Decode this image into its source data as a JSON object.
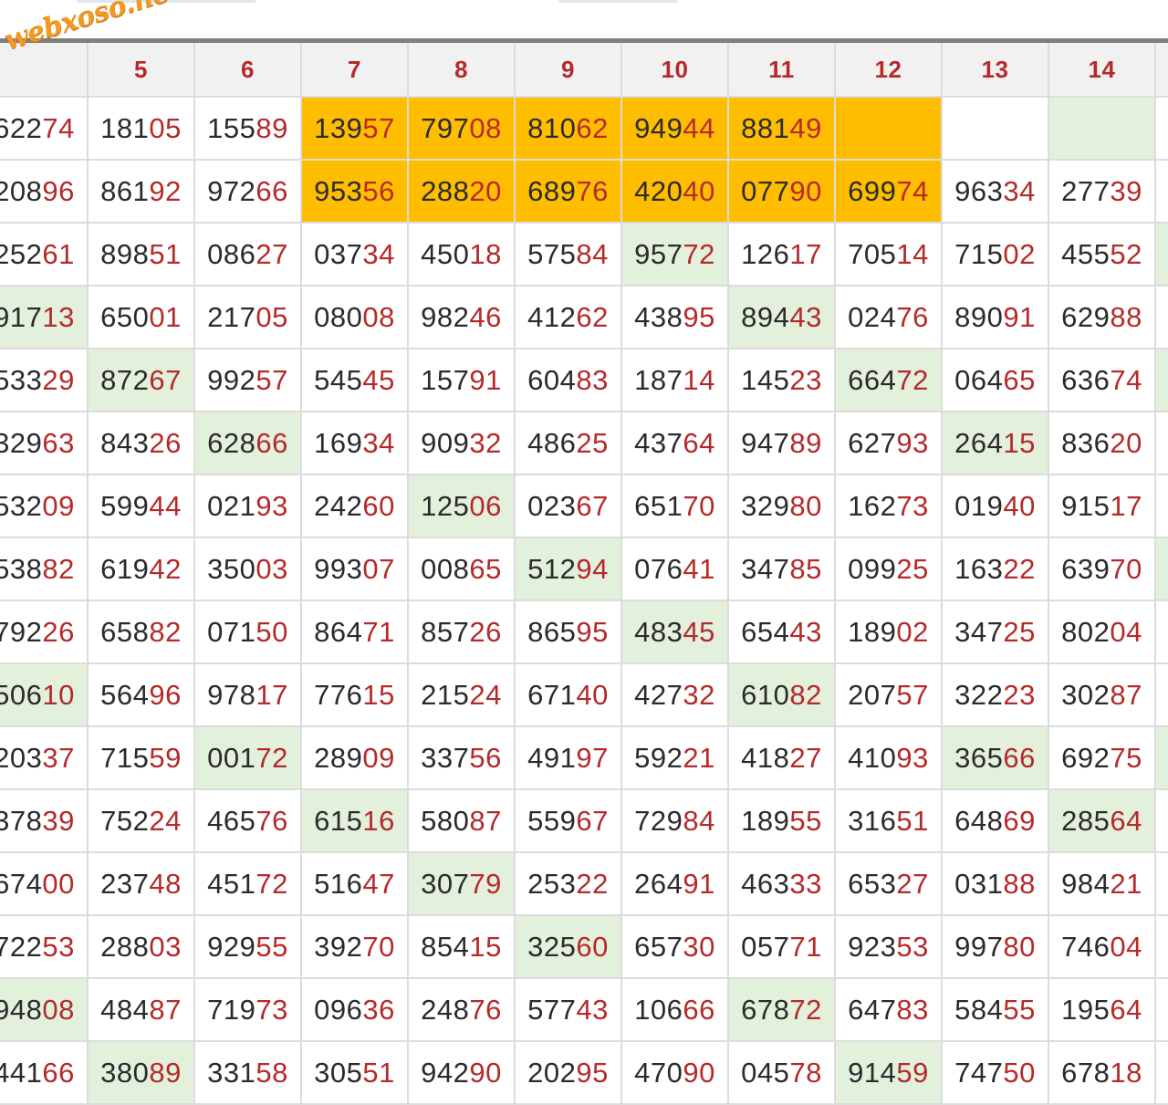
{
  "logo": {
    "text": "webxoso.net",
    "color": "#f29a22"
  },
  "colors": {
    "highlight": "#ffbd00",
    "green": "#e3f0dc",
    "header_text": "#b52a2a",
    "tail_digits": "#b52a2a"
  },
  "headers": [
    "",
    "5",
    "6",
    "7",
    "8",
    "9",
    "10",
    "11",
    "12",
    "13",
    "14"
  ],
  "rows": [
    [
      {
        "v": "62274"
      },
      {
        "v": "18105"
      },
      {
        "v": "15589"
      },
      {
        "v": "13957",
        "h": "y"
      },
      {
        "v": "79708",
        "h": "y"
      },
      {
        "v": "81062",
        "h": "y"
      },
      {
        "v": "94944",
        "h": "y"
      },
      {
        "v": "88149",
        "h": "y"
      },
      {
        "v": "",
        "h": "y"
      },
      {
        "v": ""
      },
      {
        "v": "",
        "h": "g"
      }
    ],
    [
      {
        "v": "20896"
      },
      {
        "v": "86192"
      },
      {
        "v": "97266"
      },
      {
        "v": "95356",
        "h": "y"
      },
      {
        "v": "28820",
        "h": "y"
      },
      {
        "v": "68976",
        "h": "y"
      },
      {
        "v": "42040",
        "h": "y"
      },
      {
        "v": "07790",
        "h": "y"
      },
      {
        "v": "69974",
        "h": "y"
      },
      {
        "v": "96334"
      },
      {
        "v": "27739"
      }
    ],
    [
      {
        "v": "25261"
      },
      {
        "v": "89851"
      },
      {
        "v": "08627"
      },
      {
        "v": "03734"
      },
      {
        "v": "45018"
      },
      {
        "v": "57584"
      },
      {
        "v": "95772",
        "h": "g"
      },
      {
        "v": "12617"
      },
      {
        "v": "70514"
      },
      {
        "v": "71502"
      },
      {
        "v": "45552"
      }
    ],
    [
      {
        "v": "91713",
        "h": "g"
      },
      {
        "v": "65001"
      },
      {
        "v": "21705"
      },
      {
        "v": "08008"
      },
      {
        "v": "98246"
      },
      {
        "v": "41262"
      },
      {
        "v": "43895"
      },
      {
        "v": "89443",
        "h": "g"
      },
      {
        "v": "02476"
      },
      {
        "v": "89091"
      },
      {
        "v": "62988"
      }
    ],
    [
      {
        "v": "53329"
      },
      {
        "v": "87267",
        "h": "g"
      },
      {
        "v": "99257"
      },
      {
        "v": "54545"
      },
      {
        "v": "15791"
      },
      {
        "v": "60483"
      },
      {
        "v": "18714"
      },
      {
        "v": "14523"
      },
      {
        "v": "66472",
        "h": "g"
      },
      {
        "v": "06465"
      },
      {
        "v": "63674"
      }
    ],
    [
      {
        "v": "32963"
      },
      {
        "v": "84326"
      },
      {
        "v": "62866",
        "h": "g"
      },
      {
        "v": "16934"
      },
      {
        "v": "90932"
      },
      {
        "v": "48625"
      },
      {
        "v": "43764"
      },
      {
        "v": "94789"
      },
      {
        "v": "62793"
      },
      {
        "v": "26415",
        "h": "g"
      },
      {
        "v": "83620"
      }
    ],
    [
      {
        "v": "53209"
      },
      {
        "v": "59944"
      },
      {
        "v": "02193"
      },
      {
        "v": "24260"
      },
      {
        "v": "12506",
        "h": "g"
      },
      {
        "v": "02367"
      },
      {
        "v": "65170"
      },
      {
        "v": "32980"
      },
      {
        "v": "16273"
      },
      {
        "v": "01940"
      },
      {
        "v": "91517"
      }
    ],
    [
      {
        "v": "53882"
      },
      {
        "v": "61942"
      },
      {
        "v": "35003"
      },
      {
        "v": "99307"
      },
      {
        "v": "00865"
      },
      {
        "v": "51294",
        "h": "g"
      },
      {
        "v": "07641"
      },
      {
        "v": "34785"
      },
      {
        "v": "09925"
      },
      {
        "v": "16322"
      },
      {
        "v": "63970"
      }
    ],
    [
      {
        "v": "79226"
      },
      {
        "v": "65882"
      },
      {
        "v": "07150"
      },
      {
        "v": "86471"
      },
      {
        "v": "85726"
      },
      {
        "v": "86595"
      },
      {
        "v": "48345",
        "h": "g"
      },
      {
        "v": "65443"
      },
      {
        "v": "18902"
      },
      {
        "v": "34725"
      },
      {
        "v": "80204"
      }
    ],
    [
      {
        "v": "50610",
        "h": "g"
      },
      {
        "v": "56496"
      },
      {
        "v": "97817"
      },
      {
        "v": "77615"
      },
      {
        "v": "21524"
      },
      {
        "v": "67140"
      },
      {
        "v": "42732"
      },
      {
        "v": "61082",
        "h": "g"
      },
      {
        "v": "20757"
      },
      {
        "v": "32223"
      },
      {
        "v": "30287"
      }
    ],
    [
      {
        "v": "20337"
      },
      {
        "v": "71559"
      },
      {
        "v": "00172",
        "h": "g"
      },
      {
        "v": "28909"
      },
      {
        "v": "33756"
      },
      {
        "v": "49197"
      },
      {
        "v": "59221"
      },
      {
        "v": "41827"
      },
      {
        "v": "41093"
      },
      {
        "v": "36566",
        "h": "g"
      },
      {
        "v": "69275"
      }
    ],
    [
      {
        "v": "37839"
      },
      {
        "v": "75224"
      },
      {
        "v": "46576"
      },
      {
        "v": "61516",
        "h": "g"
      },
      {
        "v": "58087"
      },
      {
        "v": "55967"
      },
      {
        "v": "72984"
      },
      {
        "v": "18955"
      },
      {
        "v": "31651"
      },
      {
        "v": "64869"
      },
      {
        "v": "28564",
        "h": "g"
      }
    ],
    [
      {
        "v": "67400"
      },
      {
        "v": "23748"
      },
      {
        "v": "45172"
      },
      {
        "v": "51647"
      },
      {
        "v": "30779",
        "h": "g"
      },
      {
        "v": "25322"
      },
      {
        "v": "26491"
      },
      {
        "v": "46333"
      },
      {
        "v": "65327"
      },
      {
        "v": "03188"
      },
      {
        "v": "98421"
      }
    ],
    [
      {
        "v": "72253"
      },
      {
        "v": "28803"
      },
      {
        "v": "92955"
      },
      {
        "v": "39270"
      },
      {
        "v": "85415"
      },
      {
        "v": "32560",
        "h": "g"
      },
      {
        "v": "65730"
      },
      {
        "v": "05771"
      },
      {
        "v": "92353"
      },
      {
        "v": "99780"
      },
      {
        "v": "74604"
      }
    ],
    [
      {
        "v": "94808",
        "h": "g"
      },
      {
        "v": "48487"
      },
      {
        "v": "71973"
      },
      {
        "v": "09636"
      },
      {
        "v": "24876"
      },
      {
        "v": "57743"
      },
      {
        "v": "10666"
      },
      {
        "v": "67872",
        "h": "g"
      },
      {
        "v": "64783"
      },
      {
        "v": "58455"
      },
      {
        "v": "19564"
      }
    ],
    [
      {
        "v": "44166"
      },
      {
        "v": "38089",
        "h": "g"
      },
      {
        "v": "33158"
      },
      {
        "v": "30551"
      },
      {
        "v": "94290"
      },
      {
        "v": "20295"
      },
      {
        "v": "47090"
      },
      {
        "v": "04578"
      },
      {
        "v": "91459",
        "h": "g"
      },
      {
        "v": "74750"
      },
      {
        "v": "67818"
      }
    ]
  ],
  "right_edge_green_rows": [
    2,
    4,
    7,
    10
  ]
}
